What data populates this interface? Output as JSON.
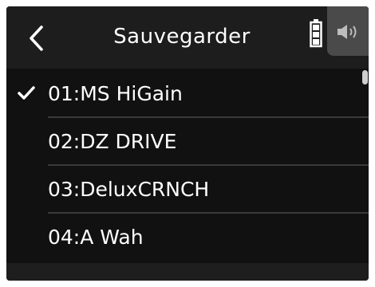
{
  "header": {
    "title": "Sauvegarder",
    "back_icon": "chevron-left-icon",
    "battery_icon": "battery-icon",
    "speaker_icon": "speaker-icon"
  },
  "list": {
    "selected_index": 0,
    "items": [
      {
        "label": "01:MS HiGain",
        "checked": true
      },
      {
        "label": "02:DZ DRIVE",
        "checked": false
      },
      {
        "label": "03:DeluxCRNCH",
        "checked": false
      },
      {
        "label": "04:A Wah",
        "checked": false
      }
    ]
  },
  "colors": {
    "background": "#111111",
    "header": "#1d1d1d",
    "text": "#ffffff",
    "divider": "#3a3a3a",
    "speaker_tab": "#4a4a4a"
  }
}
